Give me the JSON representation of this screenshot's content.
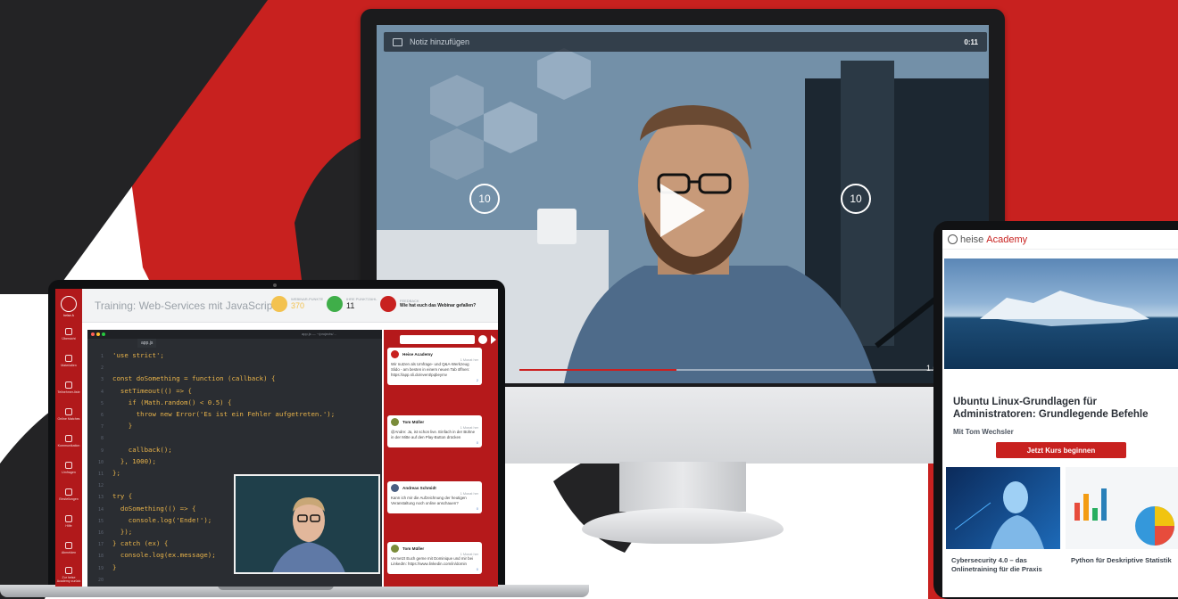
{
  "colors": {
    "brand_red": "#c8211f",
    "dark": "#232325",
    "editor_bg": "#2a2d32"
  },
  "video_player": {
    "note_label": "Notiz hinzufügen",
    "time": "0:11",
    "rewind_seconds": "10",
    "forward_seconds": "10",
    "speed": "1.0",
    "progress": 0.36,
    "icons": [
      "note-icon",
      "rewind-10-icon",
      "play-icon",
      "forward-10-icon"
    ]
  },
  "laptop_app": {
    "logo_text": "heise A",
    "sidebar": [
      {
        "label": "Übersicht",
        "icon": "compass-icon"
      },
      {
        "label": "Materialien",
        "icon": "folder-icon"
      },
      {
        "label": "Teilnehmer-liste",
        "icon": "people-icon"
      },
      {
        "label": "Online Matches",
        "icon": "connect-icon"
      },
      {
        "label": "Kommunikation",
        "icon": "chat-icon"
      },
      {
        "label": "Umfragen",
        "icon": "poll-icon"
      },
      {
        "label": "Einstellungen",
        "icon": "settings-icon"
      },
      {
        "label": "Hilfe",
        "icon": "help-icon"
      },
      {
        "label": "Abmelden",
        "icon": "logout-icon"
      },
      {
        "label": "Zur heise Academy zurück",
        "icon": "back-icon"
      }
    ],
    "title": "Training: Web-Services mit JavaScript",
    "badges": [
      {
        "label": "WEBINAR-PUNKTE",
        "value": "370",
        "color": "#f3c24f"
      },
      {
        "label": "IHRE PUNKTZAHL",
        "value": "11",
        "color": "#3fae49"
      },
      {
        "label": "FEEDBACK",
        "value": "Wie hat euch das Webinar gefallen?",
        "color": "#c8211f"
      }
    ],
    "editor": {
      "tab": "app.js",
      "file_path": "app.js — ~/projects/...",
      "lines": [
        {
          "n": "1",
          "code": "'use strict';"
        },
        {
          "n": "2",
          "code": ""
        },
        {
          "n": "3",
          "code": "const doSomething = function (callback) {"
        },
        {
          "n": "4",
          "code": "  setTimeout(() => {"
        },
        {
          "n": "5",
          "code": "    if (Math.random() < 0.5) {"
        },
        {
          "n": "6",
          "code": "      throw new Error('Es ist ein Fehler aufgetreten.');"
        },
        {
          "n": "7",
          "code": "    }"
        },
        {
          "n": "8",
          "code": ""
        },
        {
          "n": "9",
          "code": "    callback();"
        },
        {
          "n": "10",
          "code": "  }, 1000);"
        },
        {
          "n": "11",
          "code": "};"
        },
        {
          "n": "12",
          "code": ""
        },
        {
          "n": "13",
          "code": "try {"
        },
        {
          "n": "14",
          "code": "  doSomething(() => {"
        },
        {
          "n": "15",
          "code": "    console.log('Ende!');"
        },
        {
          "n": "16",
          "code": "  });"
        },
        {
          "n": "17",
          "code": "} catch (ex) {"
        },
        {
          "n": "18",
          "code": "  console.log(ex.message);"
        },
        {
          "n": "19",
          "code": "}"
        },
        {
          "n": "20",
          "code": ""
        }
      ]
    },
    "chat": [
      {
        "author": "Heise Academy",
        "time": "1 Monat her",
        "text": "Wir nutzen als Umfrage- und Q&A-Werkzeug Slido - am besten in einem neuen Tab öffnen: https://app.sli.do/event/pqbeymv",
        "likes": "2",
        "avatar": "#c8211f"
      },
      {
        "author": "Tom Müller",
        "time": "1 Monat her",
        "text": "@Andre: Ja, ist schon live. Einfach in der Bühne in der Mitte auf den Play-Button drücken",
        "likes": "0",
        "avatar": "#7a8c3a"
      },
      {
        "author": "Andreas Schmidt",
        "time": "1 Monat her",
        "text": "Kann ich mir die Aufzeichnung der heutigen Veranstaltung noch online anschauen?",
        "likes": "0",
        "avatar": "#4a5f82"
      },
      {
        "author": "Tom Müller",
        "time": "1 Monat her",
        "text": "Vernetzt Euch gerne mit Dominique und mir bei LinkedIn: https://www.linkedin.com/in/domin",
        "likes": "0",
        "avatar": "#7a8c3a"
      }
    ]
  },
  "tablet": {
    "brand": "heise",
    "brand_accent": "Academy",
    "course_title": "Ubuntu Linux-Grundlagen für Administratoren: Grundlegende Befehle",
    "author": "Mit Tom Wechsler",
    "cta": "Jetzt Kurs beginnen",
    "cards": [
      {
        "title": "Cybersecurity 4.0 – das Onlinetraining für die Praxis"
      },
      {
        "title": "Python für Deskriptive Statistik"
      }
    ]
  }
}
